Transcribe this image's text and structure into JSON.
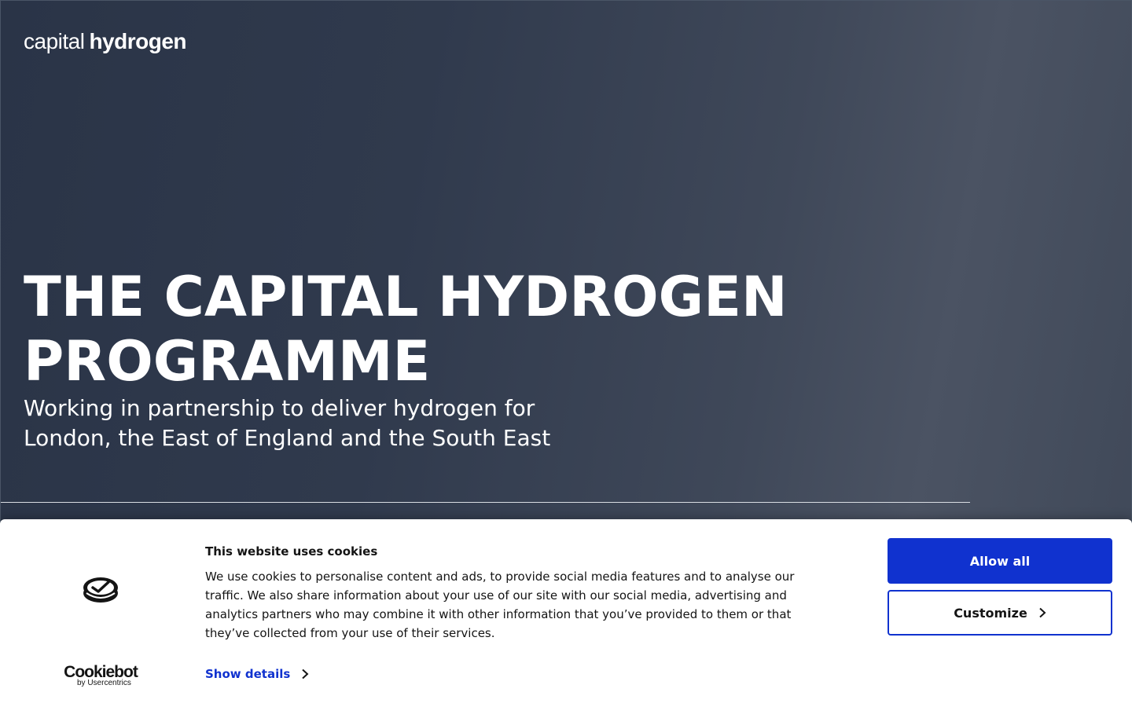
{
  "logo": {
    "light": "capital",
    "bold": "hydrogen"
  },
  "hero": {
    "title_line1": "THE CAPITAL HYDROGEN",
    "title_line2": "PROGRAMME",
    "subtitle_line1": "Working in partnership to deliver hydrogen for",
    "subtitle_line2": "London, the East of England and the South East"
  },
  "cookie_banner": {
    "brand": "Cookiebot",
    "brand_by": "by Usercentrics",
    "title": "This website uses cookies",
    "text_lines": [
      "We use cookies to personalise content and ads, to provide social media features and to analyse our",
      "traffic. We also share information about your use of our site with our social media, advertising and",
      "analytics partners who may combine it with other information that you’ve provided to them or that",
      "they’ve collected from your use of their services."
    ],
    "show_details_label": "Show details",
    "allow_all_label": "Allow all",
    "customize_label": "Customize",
    "accent_color": "#1032cf"
  }
}
